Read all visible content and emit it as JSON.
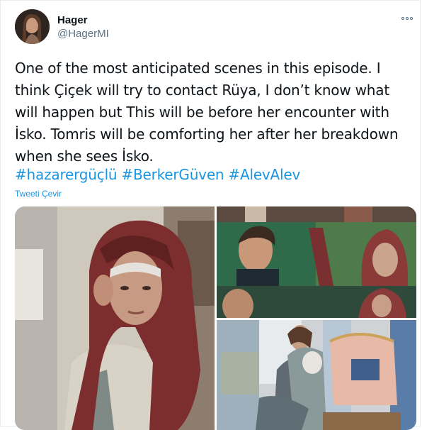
{
  "author": {
    "display_name": "Hager",
    "handle": "@HagerMI",
    "avatar_icon": "profile-photo"
  },
  "more_icon": "more-options-icon",
  "tweet_lines": [
    "One of the most anticipated scenes in this episode. I",
    "think Çiçek will try to contact Rüya, I don’t know what",
    "will happen but This will be before her encounter with",
    "İsko. Tomris will be comforting her after her breakdown",
    "when she sees İsko."
  ],
  "hashtags": [
    "#hazarergüçlü",
    "#BerkerGüven",
    "#AlevAlev"
  ],
  "translate_label": "Tweeti Çevir",
  "colors": {
    "link": "#1b95e0",
    "text": "#0f1419",
    "secondary": "#5b7083",
    "border": "#e6ecf0"
  },
  "media": [
    {
      "name": "photo-woman-headscarf"
    },
    {
      "name": "collage-man-and-woman"
    },
    {
      "name": "photo-women-embracing"
    }
  ]
}
